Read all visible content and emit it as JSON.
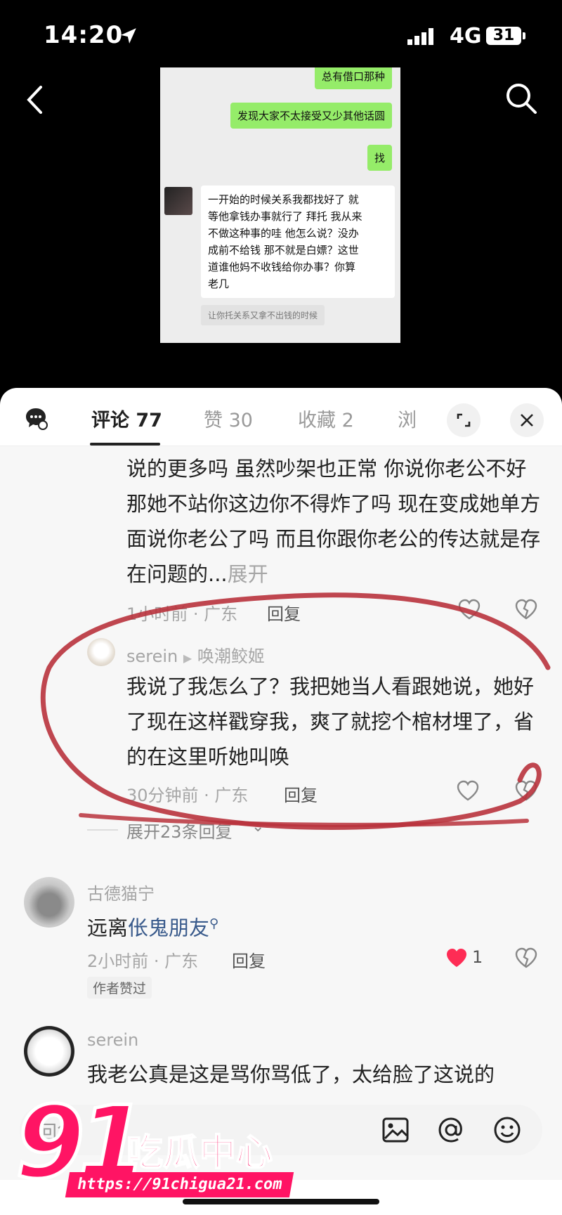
{
  "status": {
    "time": "14:20",
    "network": "4G",
    "battery": "31"
  },
  "chat": {
    "msg1": "总有借口那种",
    "msg2": "发现大家不太接受又少其他话圆",
    "msg3": "找",
    "msg4": "一开始的时候关系我都找好了 就\n等他拿钱办事就行了 拜托 我从来\n不做这种事的哇 他怎么说？没办\n成前不给钱 那不就是白嫖？这世\n道谁他妈不收钱给你办事？你算\n老几",
    "quote": "让你托关系又拿不出钱的时候"
  },
  "tabs": [
    {
      "label": "评论 77"
    },
    {
      "label": "赞 30"
    },
    {
      "label": "收藏 2"
    },
    {
      "label": "浏"
    }
  ],
  "comments": {
    "c1": {
      "text": "说的更多吗  虽然吵架也正常  你说你老公不好  那她不站你这边你不得炸了吗  现在变成她单方面说你老公了吗  而且你跟你老公的传达就是存在问题的...",
      "more": "展开",
      "meta": "1小时前 · 广东",
      "reply": "回复"
    },
    "c2": {
      "name": "serein",
      "reply_to": "唤潮鲛姬",
      "text": "我说了我怎么了？我把她当人看跟她说，她好了现在这样戳穿我，爽了就挖个棺材埋了，省的在这里听她叫唤",
      "meta": "30分钟前 · 广东",
      "reply": "回复"
    },
    "expand": "展开23条回复",
    "c3": {
      "name": "古德猫宁",
      "text_prefix": "远离",
      "text_link": "伥鬼朋友",
      "meta": "2小时前 · 广东",
      "reply": "回复",
      "likes": "1",
      "badge": "作者赞过"
    },
    "c4": {
      "name": "serein",
      "text": "我老公真是这是骂你骂低了，太给脸了这说的"
    }
  },
  "input": {
    "placeholder": "回复"
  },
  "watermark": {
    "logo": "91",
    "brand": "吃瓜中心",
    "url": "https://91chigua21.com"
  },
  "colors": {
    "accent": "#ff1464",
    "liked": "#fe2c55",
    "annotation": "#b8323c"
  }
}
